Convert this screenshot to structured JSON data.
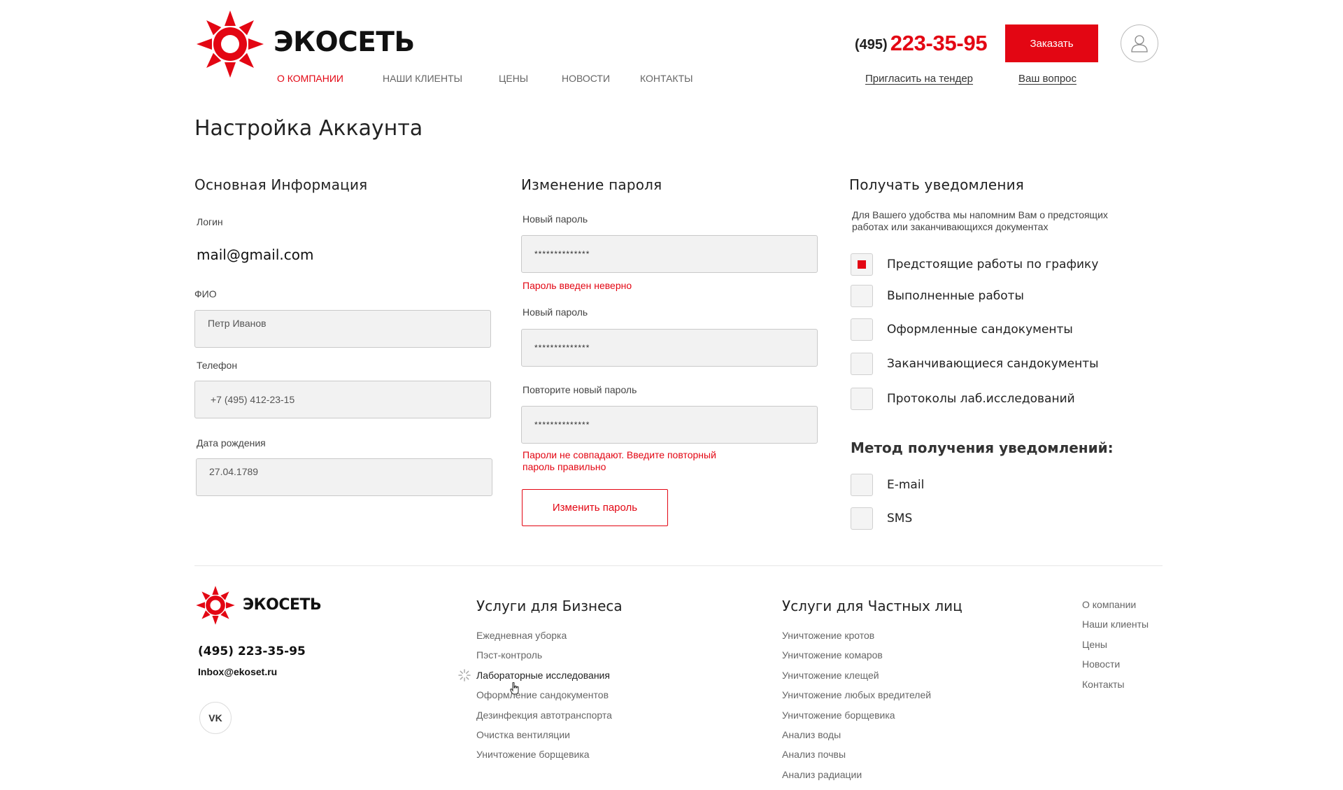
{
  "brand": {
    "name": "ЭКОСЕТЬ",
    "accent": "#e30613"
  },
  "nav": {
    "items": [
      {
        "label": "О КОМПАНИИ",
        "active": true
      },
      {
        "label": "НАШИ КЛИЕНТЫ",
        "active": false
      },
      {
        "label": "ЦЕНЫ",
        "active": false
      },
      {
        "label": "НОВОСТИ",
        "active": false
      },
      {
        "label": "КОНТАКТЫ",
        "active": false
      }
    ]
  },
  "header": {
    "phone_code": "(495)",
    "phone_number": "223-35-95",
    "order_button": "Заказать",
    "tender_link": "Пригласить на тендер",
    "question_link": "Ваш вопрос",
    "user_icon": "user-icon"
  },
  "page": {
    "title": "Настройка Аккаунта"
  },
  "basic_info": {
    "heading": "Основная Информация",
    "login_label": "Логин",
    "login_value": "mail@gmail.com",
    "fio_label": "ФИО",
    "fio_value": "Петр Иванов",
    "phone_label": "Телефон",
    "phone_value": "+7 (495) 412-23-15",
    "birth_label": "Дата рождения",
    "birth_value": "27.04.1789"
  },
  "password": {
    "heading": "Изменение пароля",
    "field1_label": "Новый пароль",
    "field1_value": "**************",
    "field1_error": "Пароль введен неверно",
    "field2_label": "Новый пароль",
    "field2_value": "**************",
    "field3_label": "Повторите новый пароль",
    "field3_value": "**************",
    "field3_error_line1": "Пароли не совпадают. Введите повторный",
    "field3_error_line2": "пароль правильно",
    "submit_button": "Изменить пароль"
  },
  "notifications": {
    "heading": "Получать уведомления",
    "hint_line1": "Для Вашего удобства мы напомним Вам о предстоящих",
    "hint_line2": "работах или заканчивающихся документах",
    "options": [
      {
        "label": "Предстоящие работы по графику",
        "checked": true
      },
      {
        "label": "Выполненные работы",
        "checked": false
      },
      {
        "label": "Оформленные сандокументы",
        "checked": false
      },
      {
        "label": "Заканчивающиеся сандокументы",
        "checked": false
      },
      {
        "label": "Протоколы лаб.исследований",
        "checked": false
      }
    ],
    "method_heading": "Метод получения уведомлений:",
    "methods": [
      {
        "label": "E-mail",
        "checked": false
      },
      {
        "label": "SMS",
        "checked": false
      }
    ]
  },
  "footer": {
    "brand": "ЭКОСЕТЬ",
    "phone": "(495) 223-35-95",
    "email": "Inbox@ekoset.ru",
    "social": "VK",
    "business_heading": "Услуги для Бизнеса",
    "business_items": [
      "Ежедневная уборка",
      "Пэст-контроль",
      "Лабораторные исследования",
      "Оформление сандокументов",
      "Дезинфекция автотранспорта",
      "Очистка вентиляции",
      "Уничтожение борщевика"
    ],
    "private_heading": "Услуги для Частных лиц",
    "private_items": [
      "Уничтожение кротов",
      "Уничтожение комаров",
      "Уничтожение клещей",
      "Уничтожение любых вредителей",
      "Уничтожение борщевика",
      "Анализ воды",
      "Анализ почвы",
      "Анализ радиации"
    ],
    "links": [
      "О компании",
      "Наши клиенты",
      "Цены",
      "Новости",
      "Контакты"
    ]
  }
}
